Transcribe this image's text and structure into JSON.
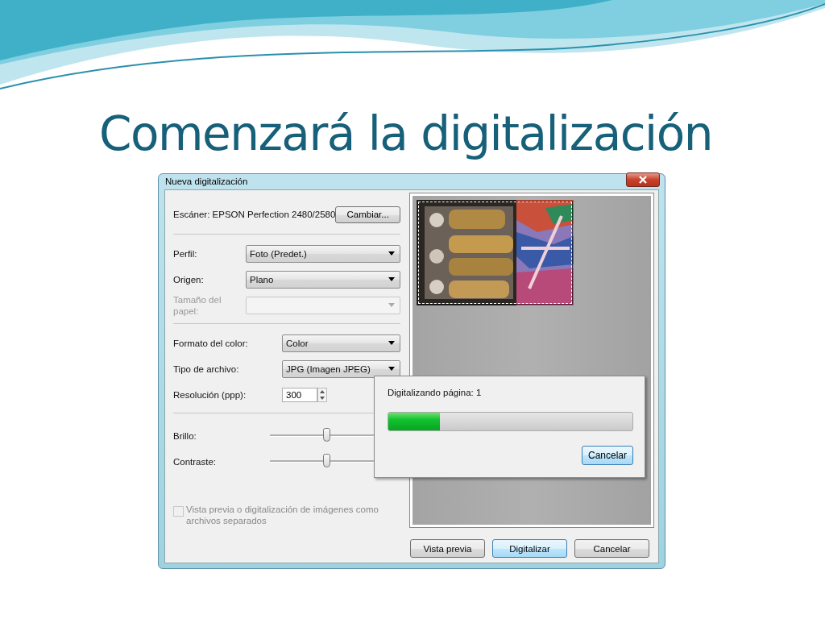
{
  "slide": {
    "title": "Comenzará la digitalización"
  },
  "dialog": {
    "title": "Nueva digitalización",
    "scanner": {
      "label": "Escáner: EPSON Perfection 2480/2580",
      "button": "Cambiar..."
    },
    "sections": [
      {
        "fields": [
          {
            "kind": "dropdown",
            "label": "Perfil:",
            "value": "Foto (Predet.)",
            "disabled": false
          },
          {
            "kind": "dropdown",
            "label": "Origen:",
            "value": "Plano",
            "disabled": false
          },
          {
            "kind": "dropdown",
            "label": "Tamaño del papel:",
            "disabled": true
          }
        ]
      },
      {
        "fields": [
          {
            "kind": "dropdown",
            "label": "Formato del color:",
            "value": "Color",
            "disabled": false
          },
          {
            "kind": "dropdown",
            "label": "Tipo de archivo:",
            "value": "JPG (Imagen JPEG)",
            "disabled": false
          },
          {
            "kind": "spinner",
            "label": "Resolución (ppp):",
            "value": "300",
            "disabled": false
          }
        ]
      },
      {
        "fields": [
          {
            "kind": "slider",
            "label": "Brillo:",
            "level": 0.5,
            "disabled": false
          },
          {
            "kind": "slider",
            "label": "Contraste:",
            "level": 0.5,
            "disabled": false
          }
        ]
      }
    ],
    "checkbox": {
      "label": "Vista previa o digitalización de imágenes como archivos separados",
      "checked": false,
      "disabled": true
    },
    "buttons": [
      {
        "label": "Vista previa",
        "default": false
      },
      {
        "label": "Digitalizar",
        "default": true
      },
      {
        "label": "Cancelar",
        "default": false
      }
    ],
    "progress": {
      "text": "Digitalizando página: 1",
      "level": 0.21,
      "button": "Cancelar"
    }
  }
}
